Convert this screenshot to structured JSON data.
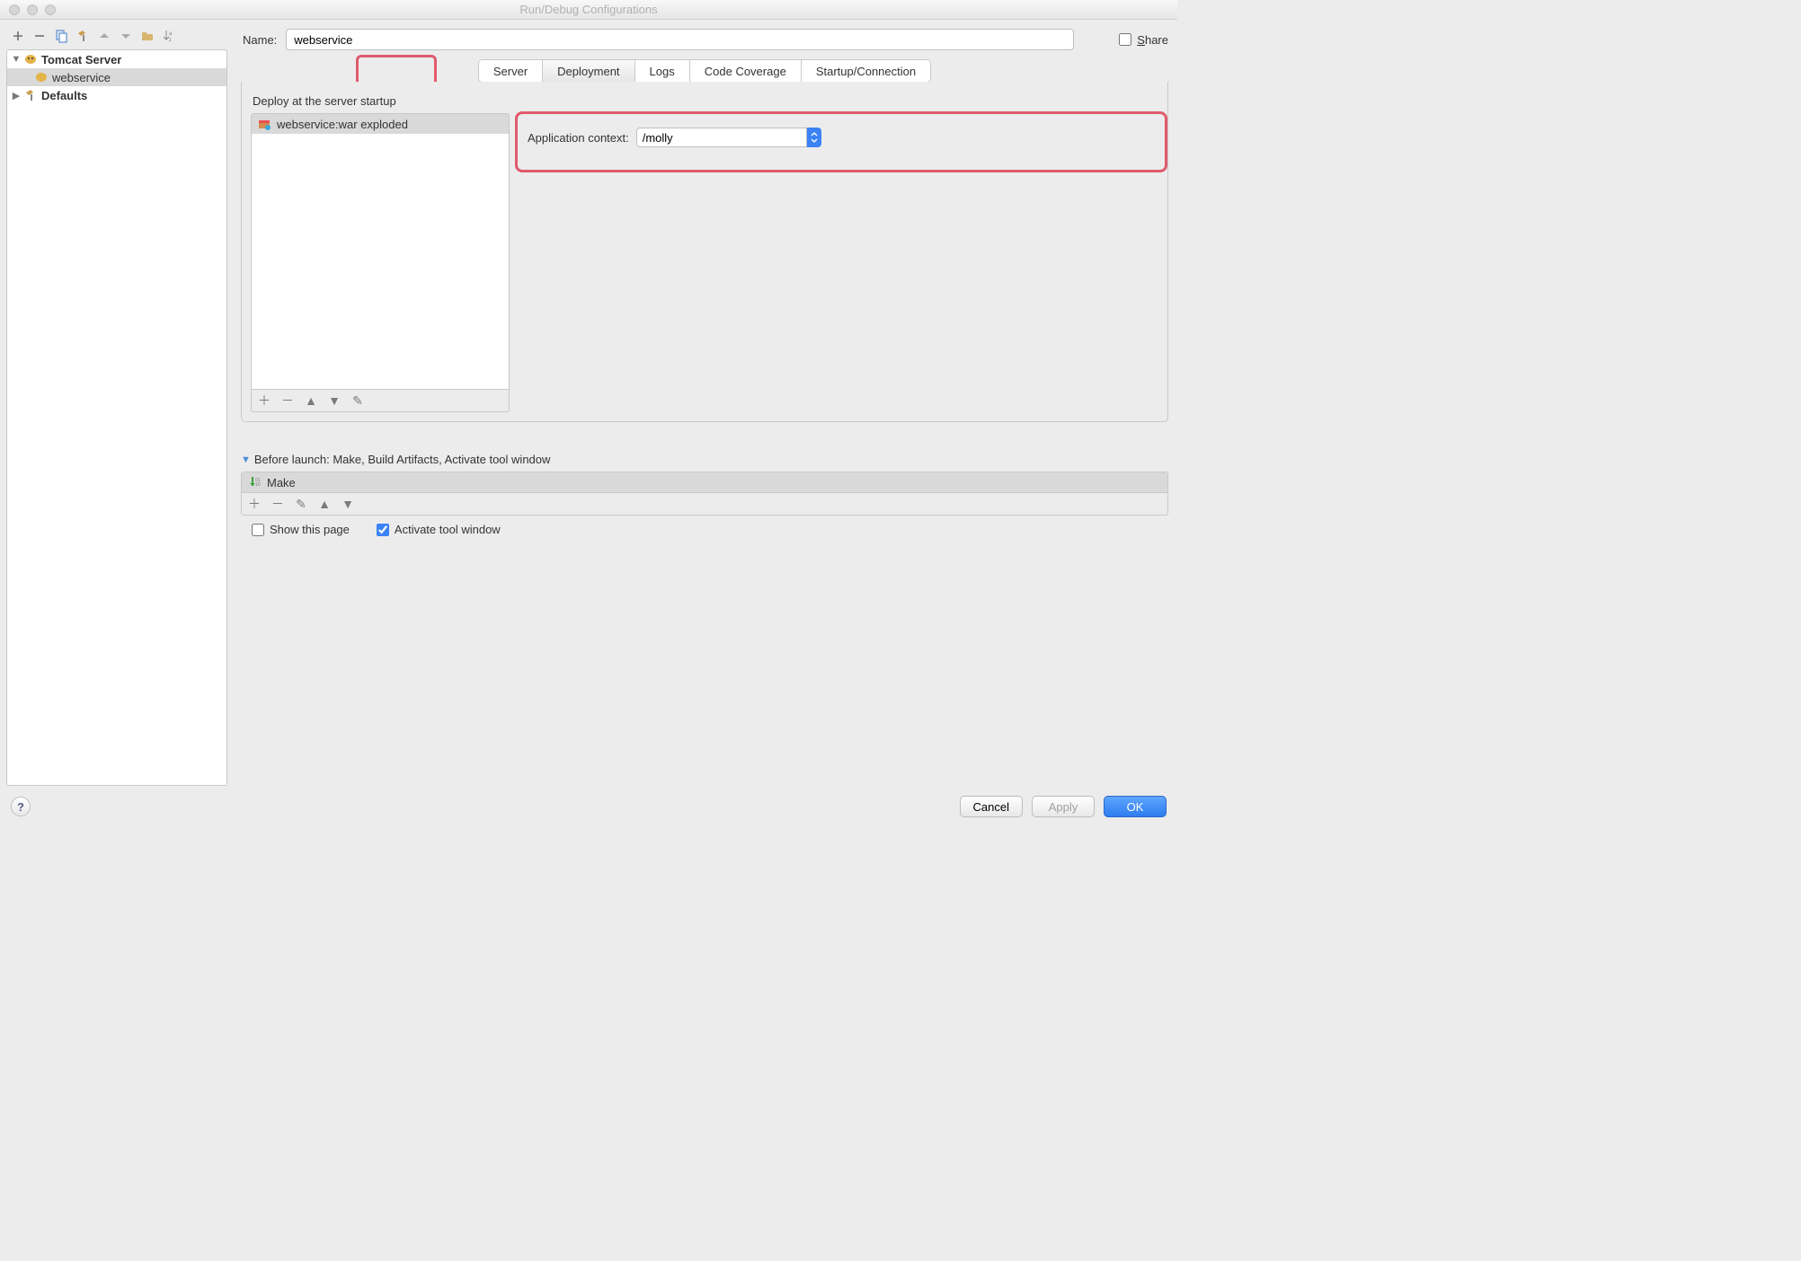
{
  "window": {
    "title": "Run/Debug Configurations"
  },
  "sidebar": {
    "tree": {
      "server_group": "Tomcat Server",
      "config_name": "webservice",
      "defaults": "Defaults"
    }
  },
  "name": {
    "label": "Name:",
    "value": "webservice",
    "share": "Share"
  },
  "tabs": {
    "server": "Server",
    "deployment": "Deployment",
    "logs": "Logs",
    "coverage": "Code Coverage",
    "startup": "Startup/Connection"
  },
  "deployment": {
    "section_title": "Deploy at the server startup",
    "artifact": "webservice:war exploded",
    "ctx_label": "Application context:",
    "ctx_value": "/molly"
  },
  "before_launch": {
    "title": "Before launch: Make, Build Artifacts, Activate tool window",
    "item": "Make",
    "show_page": "Show this page",
    "activate": "Activate tool window"
  },
  "buttons": {
    "cancel": "Cancel",
    "apply": "Apply",
    "ok": "OK"
  }
}
